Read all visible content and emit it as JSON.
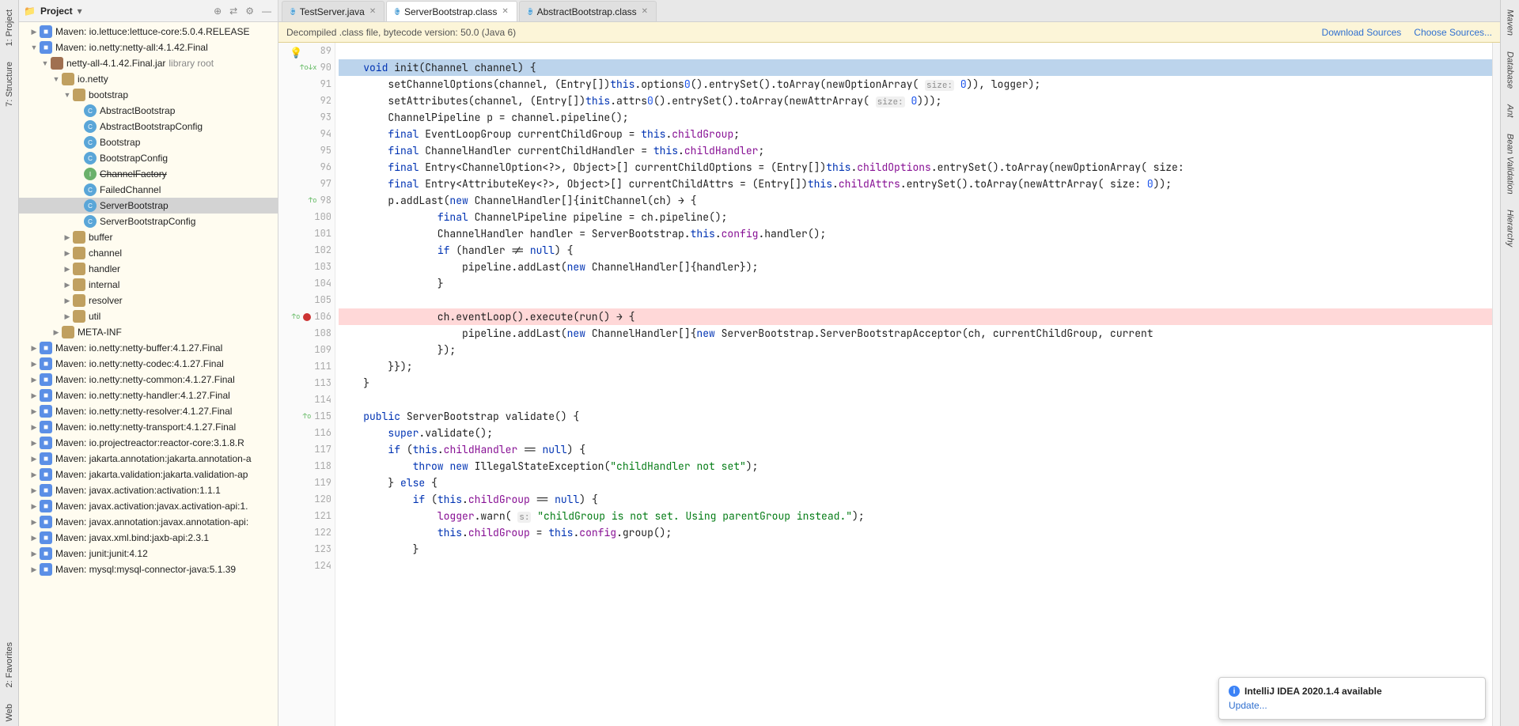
{
  "leftRail": {
    "items": [
      "1: Project",
      "7: Structure"
    ],
    "bottom": [
      "2: Favorites",
      "Web"
    ]
  },
  "rightRail": {
    "items": [
      "Maven",
      "Database",
      "Ant",
      "Bean Validation",
      "Hierarchy"
    ]
  },
  "project": {
    "title": "Project",
    "tree": [
      {
        "indent": 1,
        "exp": "▶",
        "icon": "pkg",
        "label": "Maven: io.lettuce:lettuce-core:5.0.4.RELEASE"
      },
      {
        "indent": 1,
        "exp": "▼",
        "icon": "pkg",
        "label": "Maven: io.netty:netty-all:4.1.42.Final"
      },
      {
        "indent": 2,
        "exp": "▼",
        "icon": "jar",
        "label": "netty-all-4.1.42.Final.jar",
        "suffix": "library root"
      },
      {
        "indent": 3,
        "exp": "▼",
        "icon": "folder",
        "label": "io.netty"
      },
      {
        "indent": 4,
        "exp": "▼",
        "icon": "folder",
        "label": "bootstrap"
      },
      {
        "indent": 5,
        "exp": "",
        "icon": "cls",
        "label": "AbstractBootstrap"
      },
      {
        "indent": 5,
        "exp": "",
        "icon": "cls",
        "label": "AbstractBootstrapConfig"
      },
      {
        "indent": 5,
        "exp": "",
        "icon": "cls",
        "label": "Bootstrap"
      },
      {
        "indent": 5,
        "exp": "",
        "icon": "cls",
        "label": "BootstrapConfig"
      },
      {
        "indent": 5,
        "exp": "",
        "icon": "iface",
        "label": "ChannelFactory",
        "strike": true
      },
      {
        "indent": 5,
        "exp": "",
        "icon": "cls",
        "label": "FailedChannel"
      },
      {
        "indent": 5,
        "exp": "",
        "icon": "cls",
        "label": "ServerBootstrap",
        "selected": true
      },
      {
        "indent": 5,
        "exp": "",
        "icon": "cls",
        "label": "ServerBootstrapConfig"
      },
      {
        "indent": 4,
        "exp": "▶",
        "icon": "folder",
        "label": "buffer"
      },
      {
        "indent": 4,
        "exp": "▶",
        "icon": "folder",
        "label": "channel"
      },
      {
        "indent": 4,
        "exp": "▶",
        "icon": "folder",
        "label": "handler"
      },
      {
        "indent": 4,
        "exp": "▶",
        "icon": "folder",
        "label": "internal"
      },
      {
        "indent": 4,
        "exp": "▶",
        "icon": "folder",
        "label": "resolver"
      },
      {
        "indent": 4,
        "exp": "▶",
        "icon": "folder",
        "label": "util"
      },
      {
        "indent": 3,
        "exp": "▶",
        "icon": "folder",
        "label": "META-INF"
      },
      {
        "indent": 1,
        "exp": "▶",
        "icon": "pkg",
        "label": "Maven: io.netty:netty-buffer:4.1.27.Final"
      },
      {
        "indent": 1,
        "exp": "▶",
        "icon": "pkg",
        "label": "Maven: io.netty:netty-codec:4.1.27.Final"
      },
      {
        "indent": 1,
        "exp": "▶",
        "icon": "pkg",
        "label": "Maven: io.netty:netty-common:4.1.27.Final"
      },
      {
        "indent": 1,
        "exp": "▶",
        "icon": "pkg",
        "label": "Maven: io.netty:netty-handler:4.1.27.Final"
      },
      {
        "indent": 1,
        "exp": "▶",
        "icon": "pkg",
        "label": "Maven: io.netty:netty-resolver:4.1.27.Final"
      },
      {
        "indent": 1,
        "exp": "▶",
        "icon": "pkg",
        "label": "Maven: io.netty:netty-transport:4.1.27.Final"
      },
      {
        "indent": 1,
        "exp": "▶",
        "icon": "pkg",
        "label": "Maven: io.projectreactor:reactor-core:3.1.8.R"
      },
      {
        "indent": 1,
        "exp": "▶",
        "icon": "pkg",
        "label": "Maven: jakarta.annotation:jakarta.annotation-a"
      },
      {
        "indent": 1,
        "exp": "▶",
        "icon": "pkg",
        "label": "Maven: jakarta.validation:jakarta.validation-ap"
      },
      {
        "indent": 1,
        "exp": "▶",
        "icon": "pkg",
        "label": "Maven: javax.activation:activation:1.1.1"
      },
      {
        "indent": 1,
        "exp": "▶",
        "icon": "pkg",
        "label": "Maven: javax.activation:javax.activation-api:1."
      },
      {
        "indent": 1,
        "exp": "▶",
        "icon": "pkg",
        "label": "Maven: javax.annotation:javax.annotation-api:"
      },
      {
        "indent": 1,
        "exp": "▶",
        "icon": "pkg",
        "label": "Maven: javax.xml.bind:jaxb-api:2.3.1"
      },
      {
        "indent": 1,
        "exp": "▶",
        "icon": "pkg",
        "label": "Maven: junit:junit:4.12"
      },
      {
        "indent": 1,
        "exp": "▶",
        "icon": "pkg",
        "label": "Maven: mysql:mysql-connector-java:5.1.39"
      }
    ]
  },
  "tabs": [
    {
      "label": "TestServer.java",
      "icon": "cls"
    },
    {
      "label": "ServerBootstrap.class",
      "icon": "cls",
      "active": true
    },
    {
      "label": "AbstractBootstrap.class",
      "icon": "cls"
    }
  ],
  "banner": {
    "text": "Decompiled .class file, bytecode version: 50.0 (Java 6)",
    "links": [
      "Download Sources",
      "Choose Sources..."
    ]
  },
  "code": {
    "start": 89,
    "lines": [
      {
        "n": 89,
        "txt": ""
      },
      {
        "n": 90,
        "mark": "↑o↓x",
        "caret": true,
        "bulb": true,
        "txt": "    void init(Channel channel) {",
        "hl": [
          {
            "t": "void",
            "c": "kw"
          }
        ]
      },
      {
        "n": 91,
        "txt": "        setChannelOptions(channel, (Entry[])this.options0().entrySet().toArray(newOptionArray( size: 0)), logger);",
        "hl": [
          {
            "t": "this",
            "c": "kw"
          },
          {
            "t": "0",
            "c": "num"
          }
        ],
        "hints": [
          {
            "t": "size:",
            "pos": 89
          }
        ]
      },
      {
        "n": 92,
        "txt": "        setAttributes(channel, (Entry[])this.attrs0().entrySet().toArray(newAttrArray( size: 0)));",
        "hl": [
          {
            "t": "this",
            "c": "kw"
          },
          {
            "t": "0",
            "c": "num"
          }
        ],
        "hints": [
          {
            "t": "size:",
            "pos": 82
          }
        ]
      },
      {
        "n": 93,
        "txt": "        ChannelPipeline p = channel.pipeline();"
      },
      {
        "n": 94,
        "txt": "        final EventLoopGroup currentChildGroup = this.childGroup;",
        "hl": [
          {
            "t": "final",
            "c": "kw"
          },
          {
            "t": "this",
            "c": "kw"
          },
          {
            "t": "childGroup",
            "c": "fld"
          }
        ]
      },
      {
        "n": 95,
        "txt": "        final ChannelHandler currentChildHandler = this.childHandler;",
        "hl": [
          {
            "t": "final",
            "c": "kw"
          },
          {
            "t": "this",
            "c": "kw"
          },
          {
            "t": "childHandler",
            "c": "fld"
          }
        ]
      },
      {
        "n": 96,
        "txt": "        final Entry<ChannelOption<?>, Object>[] currentChildOptions = (Entry[])this.childOptions.entrySet().toArray(newOptionArray( size:",
        "hl": [
          {
            "t": "final",
            "c": "kw"
          },
          {
            "t": "this",
            "c": "kw"
          },
          {
            "t": "childOptions",
            "c": "fld"
          }
        ]
      },
      {
        "n": 97,
        "txt": "        final Entry<AttributeKey<?>, Object>[] currentChildAttrs = (Entry[])this.childAttrs.entrySet().toArray(newAttrArray( size: 0));",
        "hl": [
          {
            "t": "final",
            "c": "kw"
          },
          {
            "t": "this",
            "c": "kw"
          },
          {
            "t": "childAttrs",
            "c": "fld"
          },
          {
            "t": "0",
            "c": "num"
          }
        ]
      },
      {
        "n": 98,
        "mark": "↑o",
        "txt": "        p.addLast(new ChannelHandler[]{initChannel(ch) → {",
        "hl": [
          {
            "t": "new",
            "c": "kw"
          }
        ]
      },
      {
        "n": 100,
        "txt": "                final ChannelPipeline pipeline = ch.pipeline();",
        "hl": [
          {
            "t": "final",
            "c": "kw"
          }
        ]
      },
      {
        "n": 101,
        "txt": "                ChannelHandler handler = ServerBootstrap.this.config.handler();",
        "hl": [
          {
            "t": "this",
            "c": "kw"
          },
          {
            "t": "config",
            "c": "fld"
          }
        ]
      },
      {
        "n": 102,
        "txt": "                if (handler != null) {",
        "hl": [
          {
            "t": "if",
            "c": "kw"
          },
          {
            "t": "null",
            "c": "kw"
          }
        ]
      },
      {
        "n": 103,
        "txt": "                    pipeline.addLast(new ChannelHandler[]{handler});",
        "hl": [
          {
            "t": "new",
            "c": "kw"
          }
        ]
      },
      {
        "n": 104,
        "txt": "                }"
      },
      {
        "n": 105,
        "txt": ""
      },
      {
        "n": 106,
        "mark": "↑o",
        "bp": true,
        "txt": "                ch.eventLoop().execute(run() → {"
      },
      {
        "n": 108,
        "txt": "                    pipeline.addLast(new ChannelHandler[]{new ServerBootstrap.ServerBootstrapAcceptor(ch, currentChildGroup, current",
        "hl": [
          {
            "t": "new",
            "c": "kw"
          }
        ]
      },
      {
        "n": 109,
        "txt": "                });"
      },
      {
        "n": 111,
        "txt": "        }});"
      },
      {
        "n": 113,
        "txt": "    }"
      },
      {
        "n": 114,
        "txt": ""
      },
      {
        "n": 115,
        "mark": "↑o",
        "txt": "    public ServerBootstrap validate() {",
        "hl": [
          {
            "t": "public",
            "c": "kw"
          }
        ]
      },
      {
        "n": 116,
        "txt": "        super.validate();",
        "hl": [
          {
            "t": "super",
            "c": "kw"
          }
        ]
      },
      {
        "n": 117,
        "txt": "        if (this.childHandler == null) {",
        "hl": [
          {
            "t": "if",
            "c": "kw"
          },
          {
            "t": "this",
            "c": "kw"
          },
          {
            "t": "childHandler",
            "c": "fld"
          },
          {
            "t": "null",
            "c": "kw"
          }
        ]
      },
      {
        "n": 118,
        "txt": "            throw new IllegalStateException(\"childHandler not set\");",
        "hl": [
          {
            "t": "throw",
            "c": "kw"
          },
          {
            "t": "new",
            "c": "kw"
          },
          {
            "t": "\"childHandler not set\"",
            "c": "str"
          }
        ]
      },
      {
        "n": 119,
        "txt": "        } else {",
        "hl": [
          {
            "t": "else",
            "c": "kw"
          }
        ]
      },
      {
        "n": 120,
        "txt": "            if (this.childGroup == null) {",
        "hl": [
          {
            "t": "if",
            "c": "kw"
          },
          {
            "t": "this",
            "c": "kw"
          },
          {
            "t": "childGroup",
            "c": "fld"
          },
          {
            "t": "null",
            "c": "kw"
          }
        ]
      },
      {
        "n": 121,
        "txt": "                logger.warn( s: \"childGroup is not set. Using parentGroup instead.\");",
        "hl": [
          {
            "t": "logger",
            "c": "fld"
          },
          {
            "t": "\"childGroup is not set. Using parentGroup instead.\"",
            "c": "str"
          }
        ],
        "hints": [
          {
            "t": "s:",
            "pos": 29
          }
        ]
      },
      {
        "n": 122,
        "txt": "                this.childGroup = this.config.group();",
        "hl": [
          {
            "t": "this",
            "c": "kw"
          },
          {
            "t": "childGroup",
            "c": "fld"
          },
          {
            "t": "config",
            "c": "fld"
          }
        ]
      },
      {
        "n": 123,
        "txt": "            }"
      },
      {
        "n": 124,
        "txt": ""
      }
    ]
  },
  "notif": {
    "title": "IntelliJ IDEA 2020.1.4 available",
    "link": "Update..."
  }
}
